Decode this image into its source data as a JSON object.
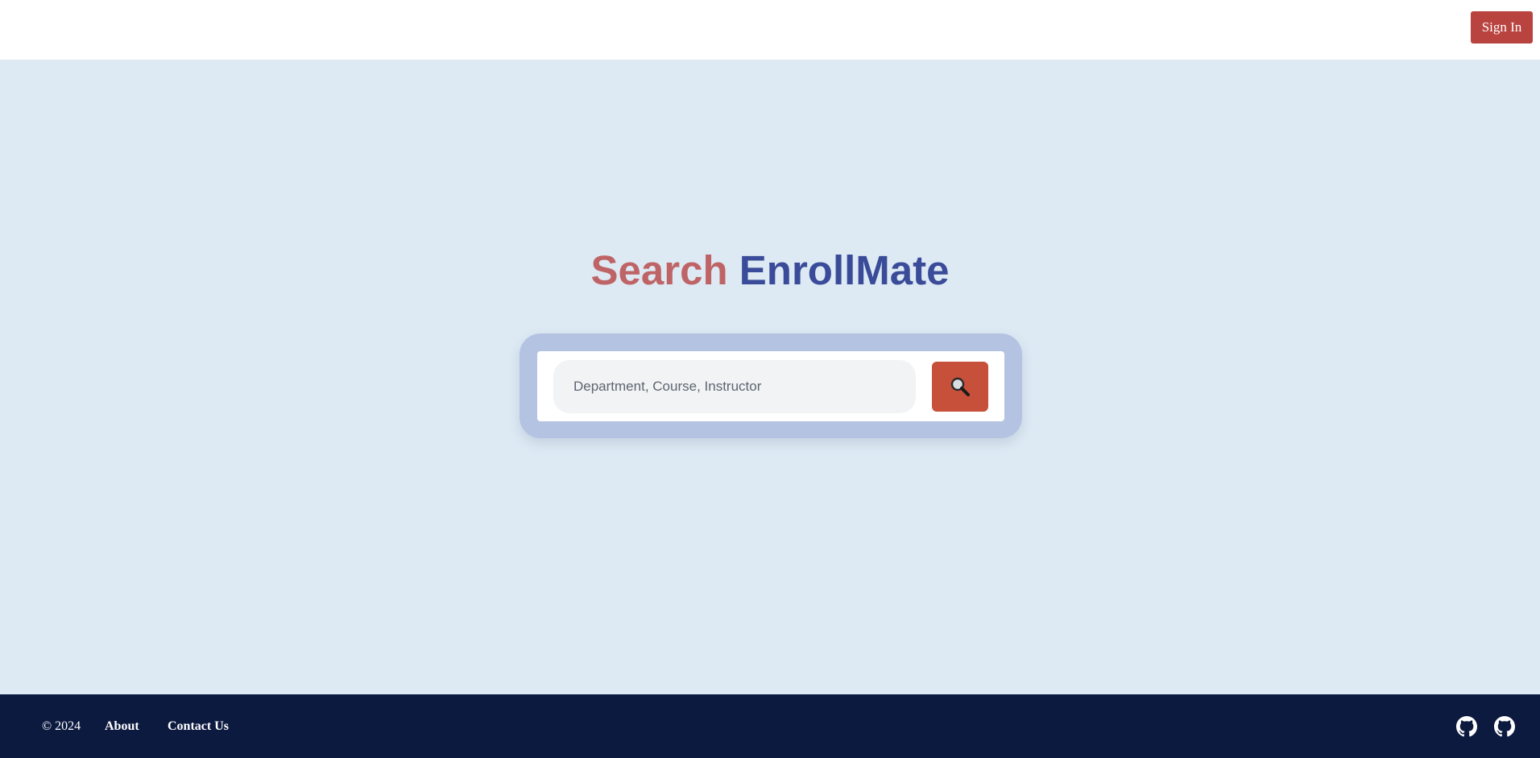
{
  "header": {
    "signin_label": "Sign In",
    "accent_color": "#b9433f"
  },
  "hero": {
    "title_part1": "Search",
    "title_part2": "EnrollMate",
    "title_color1": "#bf6466",
    "title_color2": "#3a4b99"
  },
  "search": {
    "placeholder": "Department, Course, Instructor",
    "value": "",
    "button_icon": "magnifying-glass-icon",
    "button_color": "#c65039"
  },
  "footer": {
    "copyright": "© 2024",
    "links": [
      {
        "label": "About"
      },
      {
        "label": "Contact Us"
      }
    ],
    "icons": [
      "github-icon",
      "github-icon"
    ],
    "background": "#0d1a40"
  }
}
